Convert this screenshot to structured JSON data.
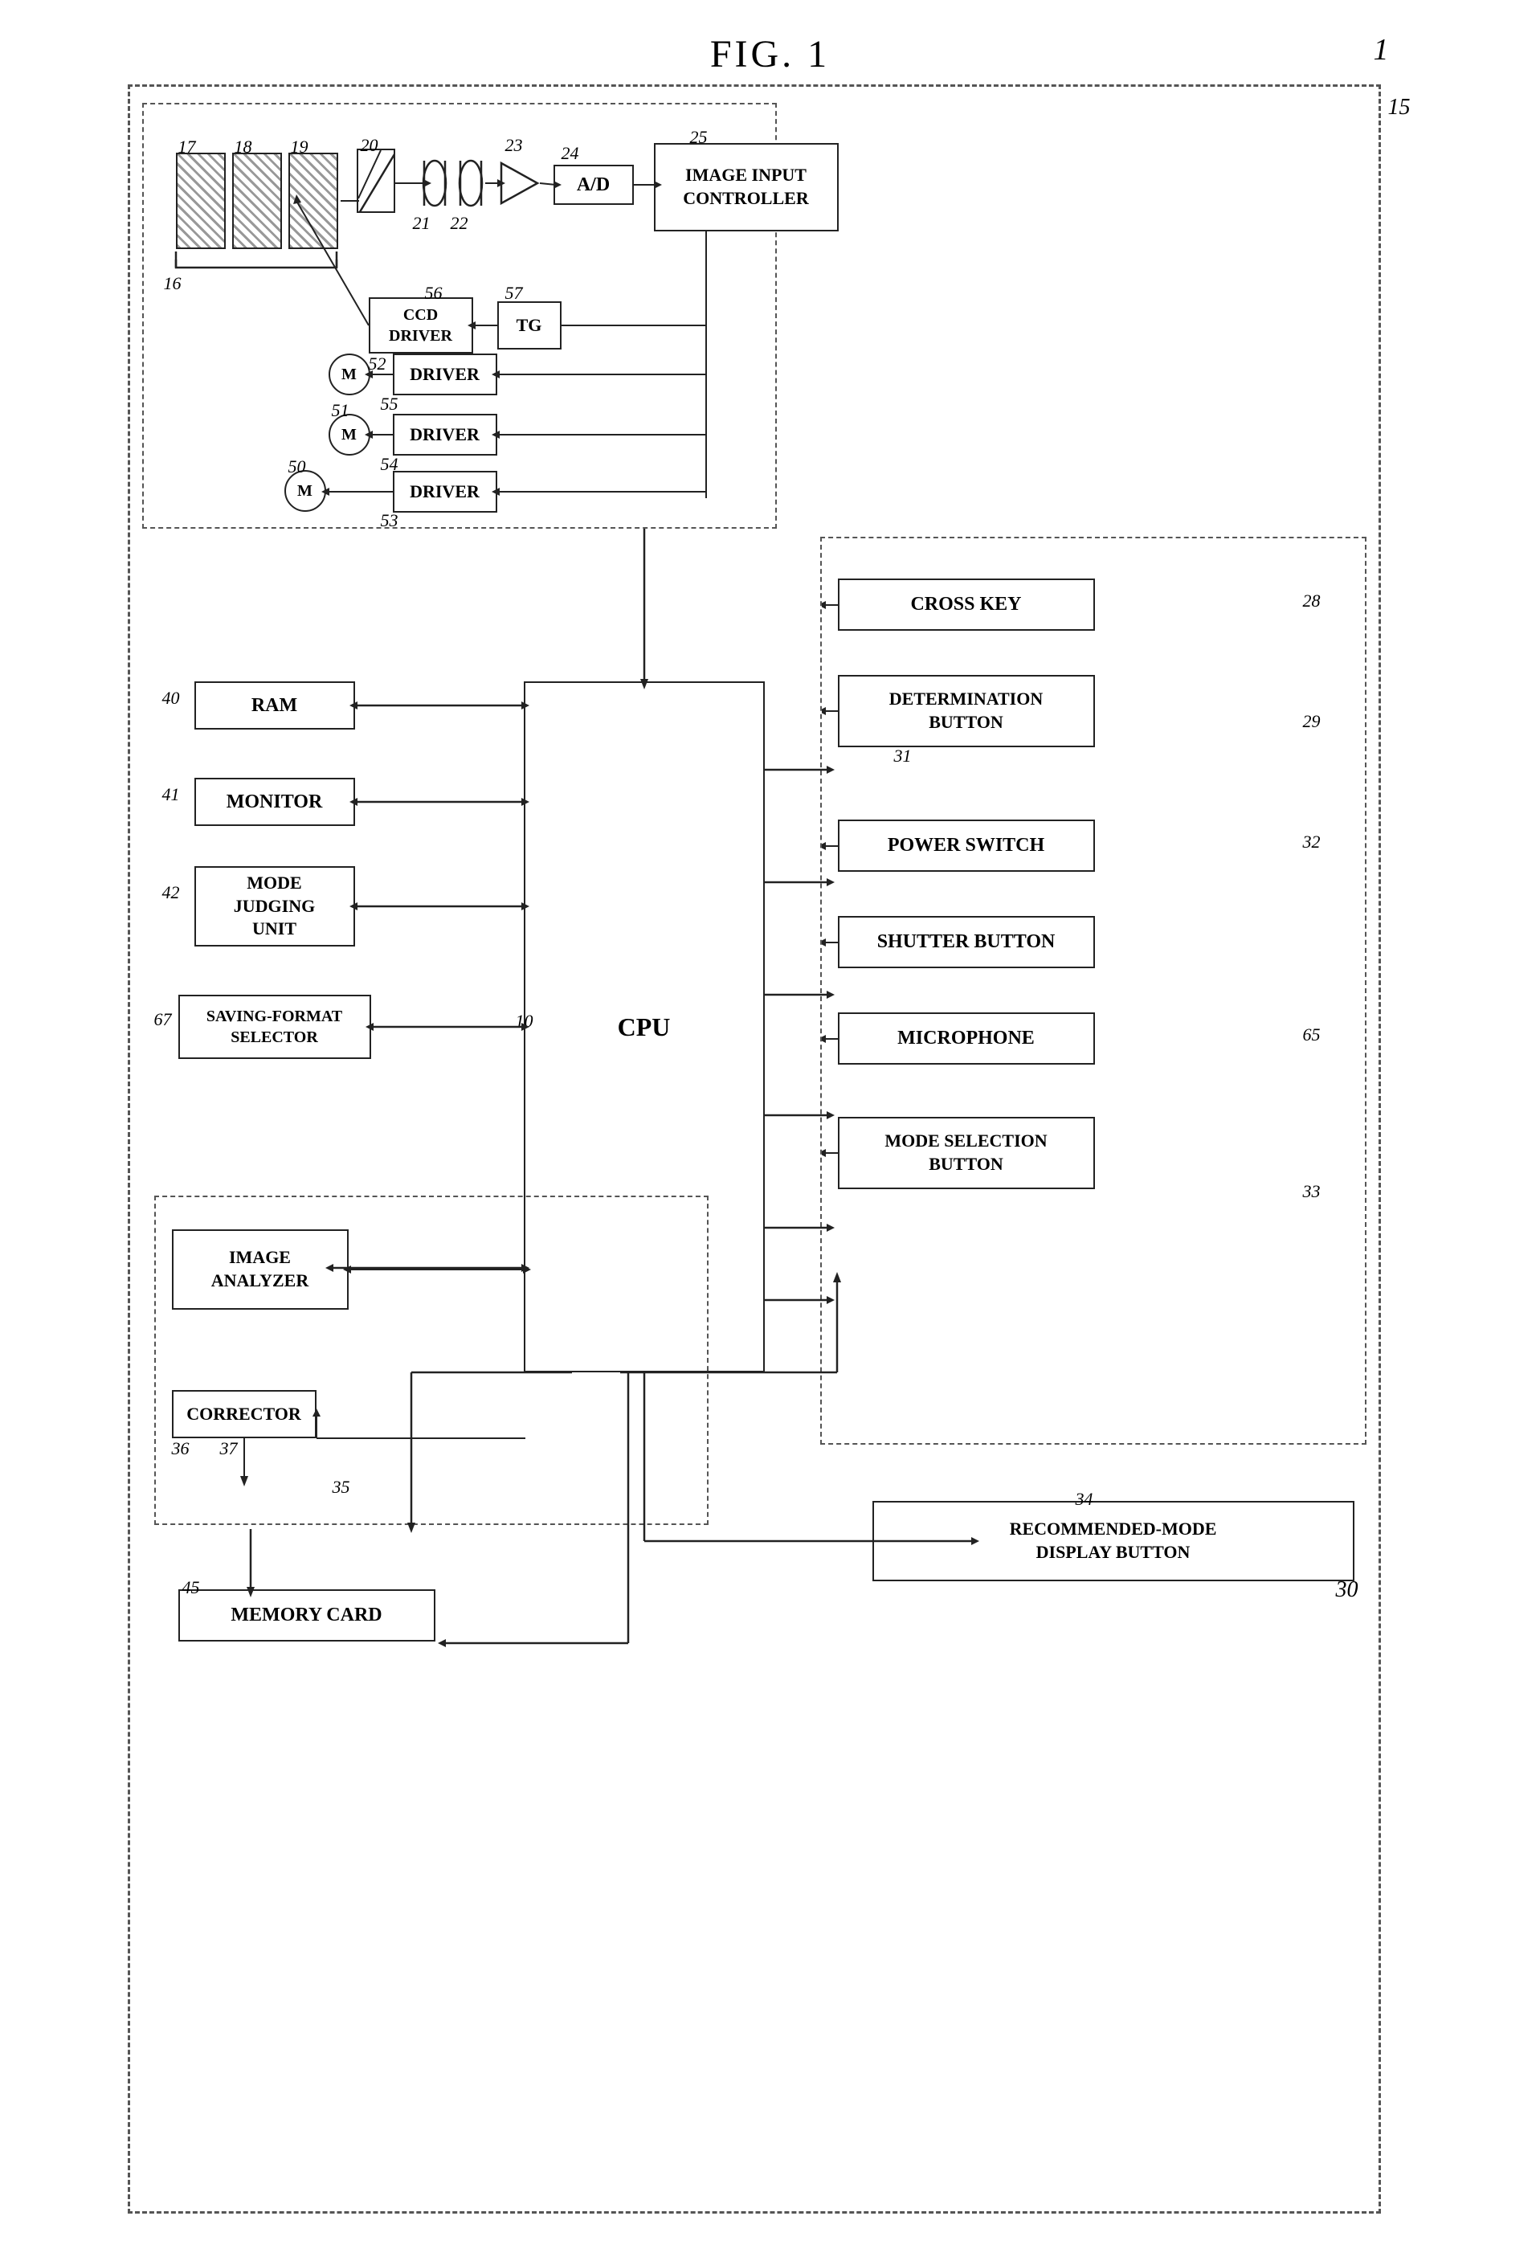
{
  "figure": {
    "title": "FIG. 1",
    "ref_number": "1"
  },
  "labels": {
    "image_input_controller": "IMAGE INPUT\nCONTROLLER",
    "ad": "A/D",
    "ccd_driver": "CCD\nDRIVER",
    "tg": "TG",
    "driver1": "DRIVER",
    "driver2": "DRIVER",
    "driver3": "DRIVER",
    "ram": "RAM",
    "monitor": "MONITOR",
    "mode_judging": "MODE\nJUDGING\nUNIT",
    "saving_format": "SAVING-FORMAT\nSELECTOR",
    "cpu": "CPU",
    "image_analyzer": "IMAGE\nANALYZER",
    "corrector": "CORRECTOR",
    "memory_card": "MEMORY CARD",
    "cross_key": "CROSS KEY",
    "determination_button": "DETERMINATION\nBUTTON",
    "power_switch": "POWER SWITCH",
    "shutter_button": "SHUTTER BUTTON",
    "microphone": "MICROPHONE",
    "mode_selection": "MODE SELECTION\nBUTTON",
    "recommended_mode": "RECOMMENDED-MODE\nDISPLAY BUTTON",
    "m": "M"
  },
  "numbers": {
    "n1": "1",
    "n10": "10",
    "n15": "15",
    "n16": "16",
    "n17": "17",
    "n18": "18",
    "n19": "19",
    "n20": "20",
    "n21": "21",
    "n22": "22",
    "n23": "23",
    "n24": "24",
    "n25": "25",
    "n28": "28",
    "n29": "29",
    "n30": "30",
    "n31": "31",
    "n32": "32",
    "n33": "33",
    "n34": "34",
    "n35": "35",
    "n36": "36",
    "n37": "37",
    "n40": "40",
    "n41": "41",
    "n42": "42",
    "n45": "45",
    "n50": "50",
    "n51": "51",
    "n52": "52",
    "n53": "53",
    "n54": "54",
    "n55": "55",
    "n56": "56",
    "n57": "57",
    "n65": "65",
    "n67": "67"
  }
}
